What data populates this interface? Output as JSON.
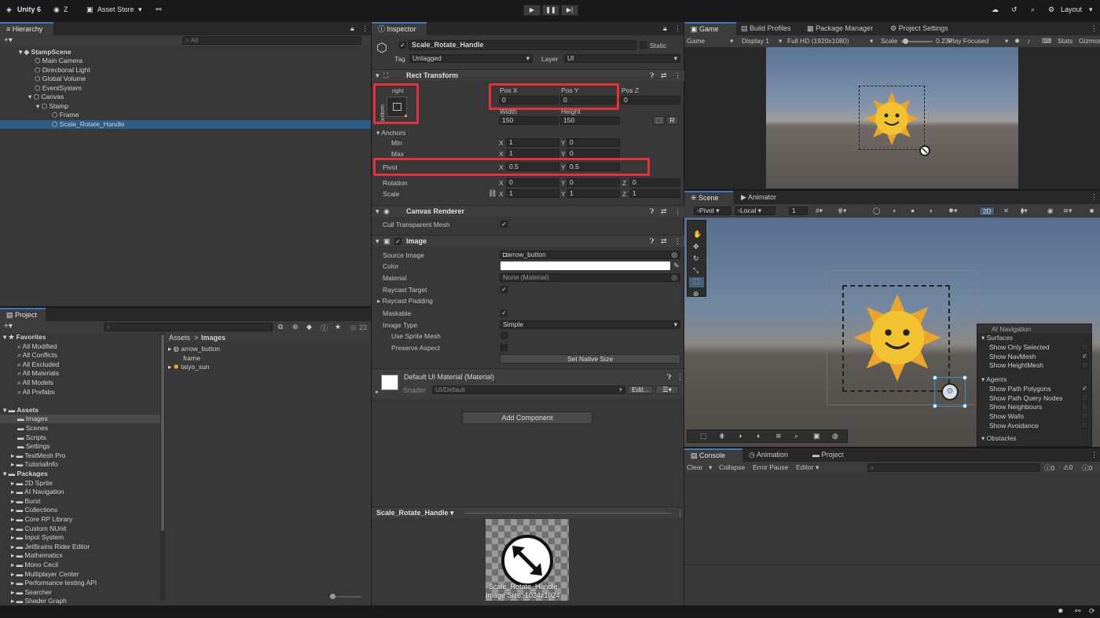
{
  "topbar": {
    "unity": "Unity 6",
    "account": "Z",
    "asset_store": "Asset Store",
    "layout": "Layout"
  },
  "hierarchy": {
    "tab": "Hierarchy",
    "search_placeholder": "All",
    "scene": "StampScene",
    "items": [
      "Main Camera",
      "Directional Light",
      "Global Volume",
      "EventSystem",
      "Canvas",
      "Stamp",
      "Frame",
      "Scale_Rotate_Handle"
    ]
  },
  "project": {
    "tab": "Project",
    "count": "23",
    "favorites_label": "Favorites",
    "favorites": [
      "All Modified",
      "All Conflicts",
      "All Excluded",
      "All Materials",
      "All Models",
      "All Prefabs"
    ],
    "assets_label": "Assets",
    "assets": [
      "Images",
      "Scenes",
      "Scripts",
      "Settings",
      "TextMesh Pro",
      "TutorialInfo"
    ],
    "packages_label": "Packages",
    "packages": [
      "2D Sprite",
      "AI Navigation",
      "Burst",
      "Collections",
      "Core RP Library",
      "Custom NUnit",
      "Input System",
      "JetBrains Rider Editor",
      "Mathematics",
      "Mono Cecil",
      "Multiplayer Center",
      "Performance testing API",
      "Searcher",
      "Shader Graph"
    ],
    "breadcrumb_root": "Assets",
    "breadcrumb_sep": ">",
    "breadcrumb_leaf": "Images",
    "files": [
      "arrow_button",
      "frame",
      "taiyo_sun"
    ]
  },
  "inspector": {
    "tab": "Inspector",
    "object_name": "Scale_Rotate_Handle",
    "static_label": "Static",
    "tag_label": "Tag",
    "tag_value": "Untagged",
    "layer_label": "Layer",
    "layer_value": "UI",
    "rect_transform": {
      "title": "Rect Transform",
      "anchor_top": "right",
      "anchor_side": "bottom",
      "posx_label": "Pos X",
      "posx": "0",
      "posy_label": "Pos Y",
      "posy": "0",
      "posz_label": "Pos Z",
      "posz": "0",
      "width_label": "Width",
      "width": "150",
      "height_label": "Height",
      "height": "150",
      "r_button": "R",
      "anchors_label": "Anchors",
      "min_label": "Min",
      "min_x": "1",
      "min_y": "0",
      "max_label": "Max",
      "max_x": "1",
      "max_y": "0",
      "pivot_label": "Pivot",
      "pivot_x": "0.5",
      "pivot_y": "0.5",
      "rotation_label": "Rotation",
      "rot_x": "0",
      "rot_y": "0",
      "rot_z": "0",
      "scale_label": "Scale",
      "scale_x": "1",
      "scale_y": "1",
      "scale_z": "1",
      "x": "X",
      "y": "Y",
      "z": "Z"
    },
    "canvas_renderer": {
      "title": "Canvas Renderer",
      "cull_label": "Cull Transparent Mesh"
    },
    "image": {
      "title": "Image",
      "source_label": "Source Image",
      "source_value": "arrow_button",
      "color_label": "Color",
      "material_label": "Material",
      "material_value": "None (Material)",
      "raycast_target": "Raycast Target",
      "raycast_padding": "Raycast Padding",
      "maskable": "Maskable",
      "image_type_label": "Image Type",
      "image_type_value": "Simple",
      "use_sprite_mesh": "Use Sprite Mesh",
      "preserve_aspect": "Preserve Aspect",
      "set_native": "Set Native Size"
    },
    "material": {
      "name": "Default UI Material (Material)",
      "shader_label": "Shader",
      "shader_value": "UI/Default",
      "edit": "Edit..."
    },
    "add_component": "Add Component",
    "preview_title": "Scale_Rotate_Handle",
    "preview_name": "Scale_Rotate_Handle",
    "preview_size": "Image Size: 1024x1024"
  },
  "game": {
    "tabs": [
      "Game",
      "Build Profiles",
      "Package Manager",
      "Project Settings"
    ],
    "mode": "Game",
    "display": "Display 1",
    "resolution": "Full HD (1920x1080)",
    "scale_label": "Scale",
    "scale_value": "0.23x",
    "play_focused": "Play Focused",
    "stats": "Stats",
    "gizmos": "Gizmos"
  },
  "scene": {
    "tabs": [
      "Scene",
      "Animator"
    ],
    "pivot": "Pivot",
    "local": "Local",
    "grid_value": "1",
    "mode_2d": "2D"
  },
  "ai_nav": {
    "title": "AI Navigation",
    "surfaces": "Surfaces",
    "surface_items": [
      {
        "label": "Show Only Selected",
        "checked": ""
      },
      {
        "label": "Show NavMesh",
        "checked": "✓"
      },
      {
        "label": "Show HeightMesh",
        "checked": ""
      }
    ],
    "agents": "Agents",
    "agent_items": [
      {
        "label": "Show Path Polygons",
        "checked": "✓"
      },
      {
        "label": "Show Path Query Nodes",
        "checked": ""
      },
      {
        "label": "Show Neighbours",
        "checked": ""
      },
      {
        "label": "Show Walls",
        "checked": ""
      },
      {
        "label": "Show Avoidance",
        "checked": ""
      }
    ],
    "obstacles": "Obstacles"
  },
  "console": {
    "tabs": [
      "Console",
      "Animation",
      "Project"
    ],
    "clear": "Clear",
    "collapse": "Collapse",
    "error_pause": "Error Pause",
    "editor": "Editor",
    "count_log": "0",
    "count_warn": "0",
    "count_err": "0"
  },
  "colors": {
    "selection": "#2c5d87",
    "highlight_box": "#e8303a",
    "sun": "#f2c230"
  }
}
